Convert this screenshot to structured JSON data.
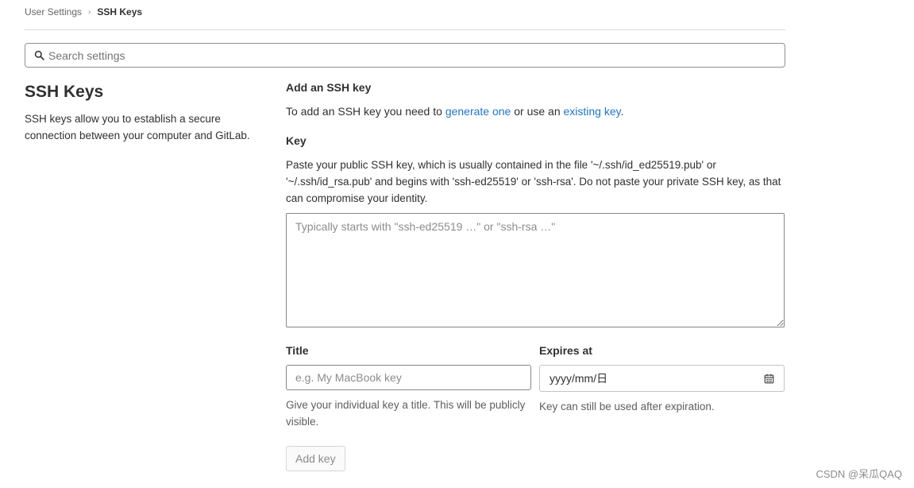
{
  "breadcrumb": {
    "parent": "User Settings",
    "separator": "›",
    "current": "SSH Keys"
  },
  "search": {
    "icon": "search-icon",
    "placeholder": "Search settings"
  },
  "left": {
    "title": "SSH Keys",
    "description": "SSH keys allow you to establish a secure connection between your computer and GitLab."
  },
  "form": {
    "heading": "Add an SSH key",
    "intro": {
      "prefix": "To add an SSH key you need to ",
      "link1": "generate one",
      "middle": " or use an ",
      "link2": "existing key",
      "suffix": "."
    },
    "key": {
      "label": "Key",
      "description": "Paste your public SSH key, which is usually contained in the file '~/.ssh/id_ed25519.pub' or '~/.ssh/id_rsa.pub' and begins with 'ssh-ed25519' or 'ssh-rsa'. Do not paste your private SSH key, as that can compromise your identity.",
      "placeholder": "Typically starts with \"ssh-ed25519 …\" or \"ssh-rsa …\"",
      "value": ""
    },
    "title": {
      "label": "Title",
      "placeholder": "e.g. My MacBook key",
      "value": "",
      "help": "Give your individual key a title. This will be publicly visible."
    },
    "expires": {
      "label": "Expires at",
      "value": "yyyy/mm/日",
      "icon": "calendar-icon",
      "help": "Key can still be used after expiration."
    },
    "submit_label": "Add key"
  },
  "watermark": "CSDN @呆瓜QAQ",
  "colors": {
    "link": "#1f75cb",
    "text": "#303030",
    "muted": "#5e5e5e",
    "border": "#868686"
  }
}
